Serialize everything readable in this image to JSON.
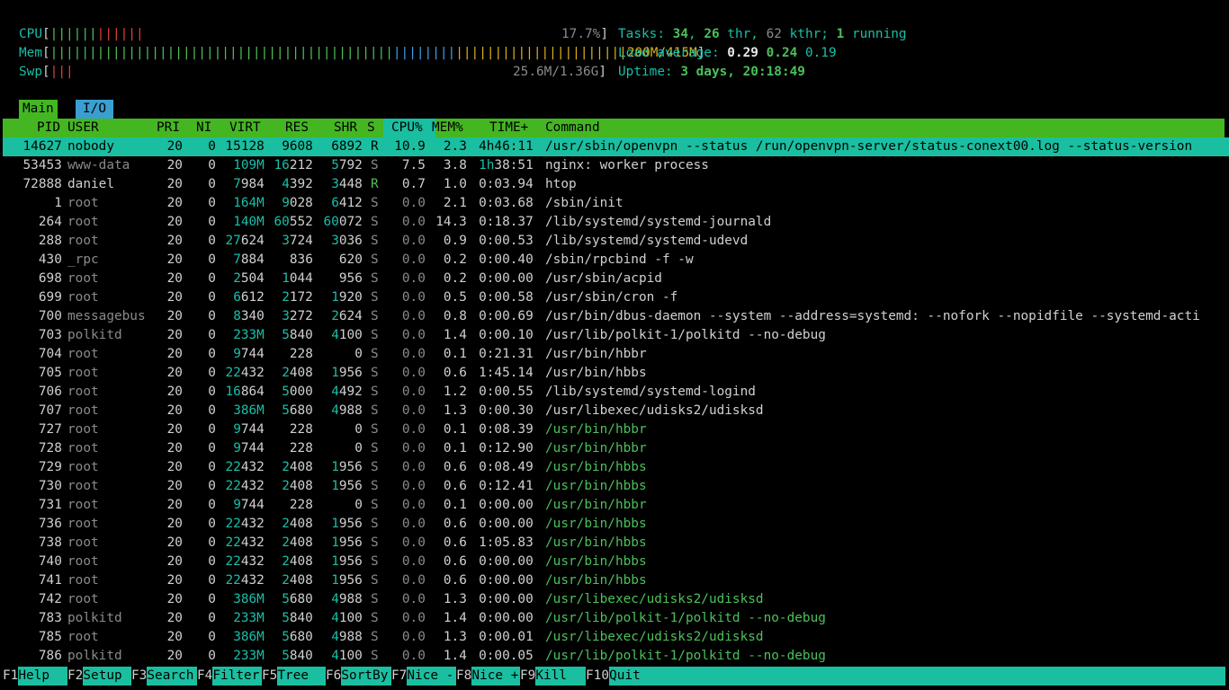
{
  "meters": {
    "cpu": {
      "label": "CPU",
      "bars_green": "||||||",
      "bars_red": "||||||",
      "value": "17.7%"
    },
    "mem": {
      "label": "Mem",
      "bars_green": "||||||||||||||||||||||||||||||||||||||||||||",
      "bars_blue": "||||||||",
      "bars_yellow": "||||||||||||||||||||||",
      "value": "200M/415M"
    },
    "swp": {
      "label": "Swp",
      "bars_red": "|||",
      "value": "25.6M/1.36G"
    }
  },
  "summary": {
    "tasks_label": "Tasks: ",
    "tasks": "34",
    "thr": "26",
    "thr_label": " thr, ",
    "kthr": "62",
    "kthr_label": " kthr; ",
    "running": "1",
    "running_label": " running",
    "load_label": "Load average: ",
    "load1": "0.29",
    "load5": "0.24",
    "load15": "0.19",
    "uptime_label": "Uptime: ",
    "uptime": "3 days, 20:18:49"
  },
  "tabs": [
    "Main",
    "I/O"
  ],
  "columns": {
    "pid": "PID",
    "user": "USER",
    "pri": "PRI",
    "ni": "NI",
    "virt": "VIRT",
    "res": "RES",
    "shr": "SHR",
    "s": "S",
    "cpu": "CPU%",
    "mem": "MEM%",
    "time": "TIME+",
    "command": "Command"
  },
  "processes": [
    {
      "pid": "14627",
      "user": "nobody",
      "pri": "20",
      "ni": "0",
      "virt": "15128",
      "res": "9608",
      "shr": "6892",
      "s": "R",
      "cpu": "10.9",
      "mem": "2.3",
      "time": "4h46:11",
      "command": "/usr/sbin/openvpn --status /run/openvpn-server/status-conext00.log --status-version"
    },
    {
      "pid": "53453",
      "user": "www-data",
      "pri": "20",
      "ni": "0",
      "virt": "109M",
      "res": "16212",
      "shr": "5792",
      "s": "S",
      "cpu": "7.5",
      "mem": "3.8",
      "time": "1h38:51",
      "command": "nginx: worker process"
    },
    {
      "pid": "72888",
      "user": "daniel",
      "pri": "20",
      "ni": "0",
      "virt": "7984",
      "res": "4392",
      "shr": "3448",
      "s": "R",
      "cpu": "0.7",
      "mem": "1.0",
      "time": "0:03.94",
      "command": "htop"
    },
    {
      "pid": "1",
      "user": "root",
      "pri": "20",
      "ni": "0",
      "virt": "164M",
      "res": "9028",
      "shr": "6412",
      "s": "S",
      "cpu": "0.0",
      "mem": "2.1",
      "time": "0:03.68",
      "command": "/sbin/init"
    },
    {
      "pid": "264",
      "user": "root",
      "pri": "20",
      "ni": "0",
      "virt": "140M",
      "res": "60552",
      "shr": "60072",
      "s": "S",
      "cpu": "0.0",
      "mem": "14.3",
      "time": "0:18.37",
      "command": "/lib/systemd/systemd-journald"
    },
    {
      "pid": "288",
      "user": "root",
      "pri": "20",
      "ni": "0",
      "virt": "27624",
      "res": "3724",
      "shr": "3036",
      "s": "S",
      "cpu": "0.0",
      "mem": "0.9",
      "time": "0:00.53",
      "command": "/lib/systemd/systemd-udevd"
    },
    {
      "pid": "430",
      "user": "_rpc",
      "pri": "20",
      "ni": "0",
      "virt": "7884",
      "res": "836",
      "shr": "620",
      "s": "S",
      "cpu": "0.0",
      "mem": "0.2",
      "time": "0:00.40",
      "command": "/sbin/rpcbind -f -w"
    },
    {
      "pid": "698",
      "user": "root",
      "pri": "20",
      "ni": "0",
      "virt": "2504",
      "res": "1044",
      "shr": "956",
      "s": "S",
      "cpu": "0.0",
      "mem": "0.2",
      "time": "0:00.00",
      "command": "/usr/sbin/acpid"
    },
    {
      "pid": "699",
      "user": "root",
      "pri": "20",
      "ni": "0",
      "virt": "6612",
      "res": "2172",
      "shr": "1920",
      "s": "S",
      "cpu": "0.0",
      "mem": "0.5",
      "time": "0:00.58",
      "command": "/usr/sbin/cron -f"
    },
    {
      "pid": "700",
      "user": "messagebus",
      "pri": "20",
      "ni": "0",
      "virt": "8340",
      "res": "3272",
      "shr": "2624",
      "s": "S",
      "cpu": "0.0",
      "mem": "0.8",
      "time": "0:00.69",
      "command": "/usr/bin/dbus-daemon --system --address=systemd: --nofork --nopidfile --systemd-acti"
    },
    {
      "pid": "703",
      "user": "polkitd",
      "pri": "20",
      "ni": "0",
      "virt": "233M",
      "res": "5840",
      "shr": "4100",
      "s": "S",
      "cpu": "0.0",
      "mem": "1.4",
      "time": "0:00.10",
      "command": "/usr/lib/polkit-1/polkitd --no-debug"
    },
    {
      "pid": "704",
      "user": "root",
      "pri": "20",
      "ni": "0",
      "virt": "9744",
      "res": "228",
      "shr": "0",
      "s": "S",
      "cpu": "0.0",
      "mem": "0.1",
      "time": "0:21.31",
      "command": "/usr/bin/hbbr"
    },
    {
      "pid": "705",
      "user": "root",
      "pri": "20",
      "ni": "0",
      "virt": "22432",
      "res": "2408",
      "shr": "1956",
      "s": "S",
      "cpu": "0.0",
      "mem": "0.6",
      "time": "1:45.14",
      "command": "/usr/bin/hbbs"
    },
    {
      "pid": "706",
      "user": "root",
      "pri": "20",
      "ni": "0",
      "virt": "16864",
      "res": "5000",
      "shr": "4492",
      "s": "S",
      "cpu": "0.0",
      "mem": "1.2",
      "time": "0:00.55",
      "command": "/lib/systemd/systemd-logind"
    },
    {
      "pid": "707",
      "user": "root",
      "pri": "20",
      "ni": "0",
      "virt": "386M",
      "res": "5680",
      "shr": "4988",
      "s": "S",
      "cpu": "0.0",
      "mem": "1.3",
      "time": "0:00.30",
      "command": "/usr/libexec/udisks2/udisksd"
    },
    {
      "pid": "727",
      "user": "root",
      "pri": "20",
      "ni": "0",
      "virt": "9744",
      "res": "228",
      "shr": "0",
      "s": "S",
      "cpu": "0.0",
      "mem": "0.1",
      "time": "0:08.39",
      "command": "/usr/bin/hbbr"
    },
    {
      "pid": "728",
      "user": "root",
      "pri": "20",
      "ni": "0",
      "virt": "9744",
      "res": "228",
      "shr": "0",
      "s": "S",
      "cpu": "0.0",
      "mem": "0.1",
      "time": "0:12.90",
      "command": "/usr/bin/hbbr"
    },
    {
      "pid": "729",
      "user": "root",
      "pri": "20",
      "ni": "0",
      "virt": "22432",
      "res": "2408",
      "shr": "1956",
      "s": "S",
      "cpu": "0.0",
      "mem": "0.6",
      "time": "0:08.49",
      "command": "/usr/bin/hbbs"
    },
    {
      "pid": "730",
      "user": "root",
      "pri": "20",
      "ni": "0",
      "virt": "22432",
      "res": "2408",
      "shr": "1956",
      "s": "S",
      "cpu": "0.0",
      "mem": "0.6",
      "time": "0:12.41",
      "command": "/usr/bin/hbbs"
    },
    {
      "pid": "731",
      "user": "root",
      "pri": "20",
      "ni": "0",
      "virt": "9744",
      "res": "228",
      "shr": "0",
      "s": "S",
      "cpu": "0.0",
      "mem": "0.1",
      "time": "0:00.00",
      "command": "/usr/bin/hbbr"
    },
    {
      "pid": "736",
      "user": "root",
      "pri": "20",
      "ni": "0",
      "virt": "22432",
      "res": "2408",
      "shr": "1956",
      "s": "S",
      "cpu": "0.0",
      "mem": "0.6",
      "time": "0:00.00",
      "command": "/usr/bin/hbbs"
    },
    {
      "pid": "738",
      "user": "root",
      "pri": "20",
      "ni": "0",
      "virt": "22432",
      "res": "2408",
      "shr": "1956",
      "s": "S",
      "cpu": "0.0",
      "mem": "0.6",
      "time": "1:05.83",
      "command": "/usr/bin/hbbs"
    },
    {
      "pid": "740",
      "user": "root",
      "pri": "20",
      "ni": "0",
      "virt": "22432",
      "res": "2408",
      "shr": "1956",
      "s": "S",
      "cpu": "0.0",
      "mem": "0.6",
      "time": "0:00.00",
      "command": "/usr/bin/hbbs"
    },
    {
      "pid": "741",
      "user": "root",
      "pri": "20",
      "ni": "0",
      "virt": "22432",
      "res": "2408",
      "shr": "1956",
      "s": "S",
      "cpu": "0.0",
      "mem": "0.6",
      "time": "0:00.00",
      "command": "/usr/bin/hbbs"
    },
    {
      "pid": "742",
      "user": "root",
      "pri": "20",
      "ni": "0",
      "virt": "386M",
      "res": "5680",
      "shr": "4988",
      "s": "S",
      "cpu": "0.0",
      "mem": "1.3",
      "time": "0:00.00",
      "command": "/usr/libexec/udisks2/udisksd"
    },
    {
      "pid": "783",
      "user": "polkitd",
      "pri": "20",
      "ni": "0",
      "virt": "233M",
      "res": "5840",
      "shr": "4100",
      "s": "S",
      "cpu": "0.0",
      "mem": "1.4",
      "time": "0:00.00",
      "command": "/usr/lib/polkit-1/polkitd --no-debug"
    },
    {
      "pid": "785",
      "user": "root",
      "pri": "20",
      "ni": "0",
      "virt": "386M",
      "res": "5680",
      "shr": "4988",
      "s": "S",
      "cpu": "0.0",
      "mem": "1.3",
      "time": "0:00.01",
      "command": "/usr/libexec/udisks2/udisksd"
    },
    {
      "pid": "786",
      "user": "polkitd",
      "pri": "20",
      "ni": "0",
      "virt": "233M",
      "res": "5840",
      "shr": "4100",
      "s": "S",
      "cpu": "0.0",
      "mem": "1.4",
      "time": "0:00.05",
      "command": "/usr/lib/polkit-1/polkitd --no-debug"
    }
  ],
  "function_keys": [
    {
      "key": "F1",
      "label": "Help"
    },
    {
      "key": "F2",
      "label": "Setup"
    },
    {
      "key": "F3",
      "label": "Search"
    },
    {
      "key": "F4",
      "label": "Filter"
    },
    {
      "key": "F5",
      "label": "Tree"
    },
    {
      "key": "F6",
      "label": "SortBy"
    },
    {
      "key": "F7",
      "label": "Nice -"
    },
    {
      "key": "F8",
      "label": "Nice +"
    },
    {
      "key": "F9",
      "label": "Kill"
    },
    {
      "key": "F10",
      "label": "Quit"
    }
  ],
  "colors": {
    "accent_green": "#44b622",
    "selection": "#19bfa0",
    "thread_green": "#4cc05a"
  }
}
